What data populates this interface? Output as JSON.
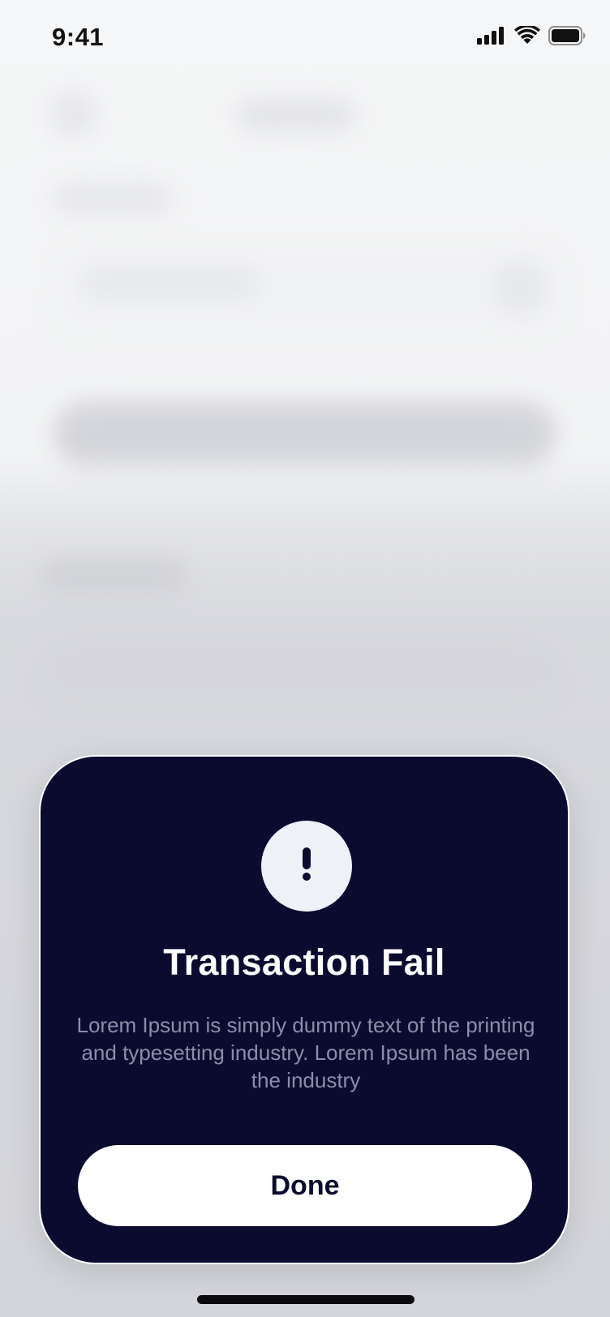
{
  "status_bar": {
    "time": "9:41",
    "icons": [
      "signal-icon",
      "wifi-icon",
      "battery-icon"
    ]
  },
  "modal": {
    "icon": "exclamation-icon",
    "title": "Transaction Fail",
    "message": "Lorem Ipsum is simply dummy text of the printing and typesetting industry. Lorem Ipsum has been the industry",
    "done_label": "Done"
  },
  "colors": {
    "modal_background": "#0a0b2f",
    "message_text": "#8c8ea8",
    "icon_circle": "#eef2f7",
    "button_background": "#ffffff"
  }
}
